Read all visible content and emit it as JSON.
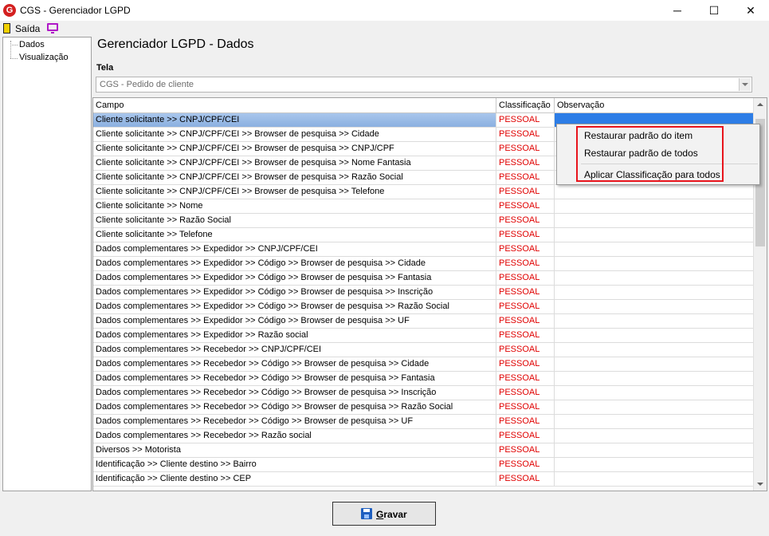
{
  "window": {
    "title": "CGS - Gerenciador LGPD",
    "app_icon_letter": "G",
    "minimize": "─",
    "maximize": "☐",
    "close": "✕"
  },
  "toolbar": {
    "exit_label": "Saída"
  },
  "sidebar": {
    "items": [
      {
        "label": "Dados"
      },
      {
        "label": "Visualização"
      }
    ]
  },
  "main": {
    "title": "Gerenciador LGPD - Dados",
    "tela_label": "Tela",
    "tela_value": "CGS - Pedido de cliente"
  },
  "grid": {
    "columns": [
      "Campo",
      "Classificação",
      "Observação"
    ],
    "rows": [
      {
        "campo": "Cliente solicitante >> CNPJ/CPF/CEI",
        "classificacao": "PESSOAL",
        "observacao": ""
      },
      {
        "campo": "Cliente solicitante >> CNPJ/CPF/CEI >> Browser de pesquisa >> Cidade",
        "classificacao": "PESSOAL",
        "observacao": ""
      },
      {
        "campo": "Cliente solicitante >> CNPJ/CPF/CEI >> Browser de pesquisa >> CNPJ/CPF",
        "classificacao": "PESSOAL",
        "observacao": ""
      },
      {
        "campo": "Cliente solicitante >> CNPJ/CPF/CEI >> Browser de pesquisa >> Nome Fantasia",
        "classificacao": "PESSOAL",
        "observacao": ""
      },
      {
        "campo": "Cliente solicitante >> CNPJ/CPF/CEI >> Browser de pesquisa >> Razão Social",
        "classificacao": "PESSOAL",
        "observacao": ""
      },
      {
        "campo": "Cliente solicitante >> CNPJ/CPF/CEI >> Browser de pesquisa >> Telefone",
        "classificacao": "PESSOAL",
        "observacao": ""
      },
      {
        "campo": "Cliente solicitante >> Nome",
        "classificacao": "PESSOAL",
        "observacao": ""
      },
      {
        "campo": "Cliente solicitante >> Razão Social",
        "classificacao": "PESSOAL",
        "observacao": ""
      },
      {
        "campo": "Cliente solicitante >> Telefone",
        "classificacao": "PESSOAL",
        "observacao": ""
      },
      {
        "campo": "Dados complementares >> Expedidor >> CNPJ/CPF/CEI",
        "classificacao": "PESSOAL",
        "observacao": ""
      },
      {
        "campo": "Dados complementares >> Expedidor >> Código >> Browser de pesquisa >> Cidade",
        "classificacao": "PESSOAL",
        "observacao": ""
      },
      {
        "campo": "Dados complementares >> Expedidor >> Código >> Browser de pesquisa >> Fantasia",
        "classificacao": "PESSOAL",
        "observacao": ""
      },
      {
        "campo": "Dados complementares >> Expedidor >> Código >> Browser de pesquisa >> Inscrição",
        "classificacao": "PESSOAL",
        "observacao": ""
      },
      {
        "campo": "Dados complementares >> Expedidor >> Código >> Browser de pesquisa >> Razão Social",
        "classificacao": "PESSOAL",
        "observacao": ""
      },
      {
        "campo": "Dados complementares >> Expedidor >> Código >> Browser de pesquisa >> UF",
        "classificacao": "PESSOAL",
        "observacao": ""
      },
      {
        "campo": "Dados complementares >> Expedidor >> Razão social",
        "classificacao": "PESSOAL",
        "observacao": ""
      },
      {
        "campo": "Dados complementares >> Recebedor >> CNPJ/CPF/CEI",
        "classificacao": "PESSOAL",
        "observacao": ""
      },
      {
        "campo": "Dados complementares >> Recebedor >> Código >> Browser de pesquisa >> Cidade",
        "classificacao": "PESSOAL",
        "observacao": ""
      },
      {
        "campo": "Dados complementares >> Recebedor >> Código >> Browser de pesquisa >> Fantasia",
        "classificacao": "PESSOAL",
        "observacao": ""
      },
      {
        "campo": "Dados complementares >> Recebedor >> Código >> Browser de pesquisa >> Inscrição",
        "classificacao": "PESSOAL",
        "observacao": ""
      },
      {
        "campo": "Dados complementares >> Recebedor >> Código >> Browser de pesquisa >> Razão Social",
        "classificacao": "PESSOAL",
        "observacao": ""
      },
      {
        "campo": "Dados complementares >> Recebedor >> Código >> Browser de pesquisa >> UF",
        "classificacao": "PESSOAL",
        "observacao": ""
      },
      {
        "campo": "Dados complementares >> Recebedor >> Razão social",
        "classificacao": "PESSOAL",
        "observacao": ""
      },
      {
        "campo": "Diversos >> Motorista",
        "classificacao": "PESSOAL",
        "observacao": ""
      },
      {
        "campo": "Identificação  >> Cliente destino >> Bairro",
        "classificacao": "PESSOAL",
        "observacao": ""
      },
      {
        "campo": "Identificação  >> Cliente destino >> CEP",
        "classificacao": "PESSOAL",
        "observacao": ""
      }
    ]
  },
  "context_menu": {
    "items": [
      "Restaurar padrão do item",
      "Restaurar padrão de todos",
      "Aplicar Classificação para todos"
    ]
  },
  "footer": {
    "save_label": "Gravar"
  },
  "colors": {
    "classification_text": "#e00000",
    "selection": "#2d7de6",
    "highlight_box": "#e8141c"
  }
}
